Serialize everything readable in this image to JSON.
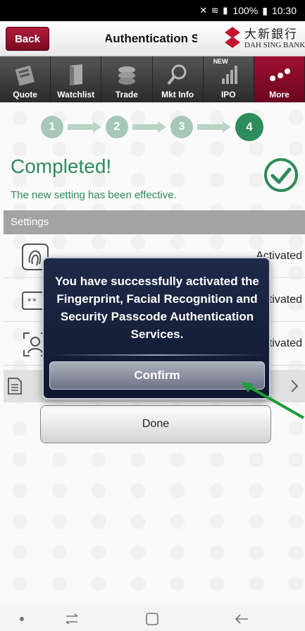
{
  "status_bar": {
    "battery": "100%",
    "time": "10:30"
  },
  "header": {
    "back_label": "Back",
    "title": "Authentication Settings",
    "logo_chinese": "大新銀行",
    "logo_english": "DAH SING BANK"
  },
  "nav": {
    "items": [
      {
        "label": "Quote",
        "icon": "quote-icon"
      },
      {
        "label": "Watchlist",
        "icon": "watchlist-icon"
      },
      {
        "label": "Trade",
        "icon": "trade-icon"
      },
      {
        "label": "Mkt Info",
        "icon": "mkt-info-icon"
      },
      {
        "label": "IPO",
        "icon": "ipo-icon",
        "tag": "NEW"
      },
      {
        "label": "More",
        "icon": "more-icon"
      }
    ],
    "active_color": "#a00f30"
  },
  "steps": [
    "1",
    "2",
    "3",
    "4"
  ],
  "completed": {
    "title": "Completed!",
    "subtitle": "The new setting has been effective."
  },
  "settings": {
    "header": "Settings",
    "rows": [
      {
        "icon": "fingerprint-icon",
        "status": "Activated"
      },
      {
        "icon": "passcode-icon",
        "status": "Activated"
      },
      {
        "icon": "face-recognition-icon",
        "status": "Activated"
      }
    ]
  },
  "done_label": "Done",
  "dialog": {
    "message": "You have successfully activated the Fingerprint, Facial Recognition and Security Passcode Authentication Services.",
    "confirm_label": "Confirm"
  },
  "colors": {
    "accent_green": "#2e8b5a",
    "brand_red": "#a00f30",
    "dialog_bg": "#1e2a48"
  }
}
